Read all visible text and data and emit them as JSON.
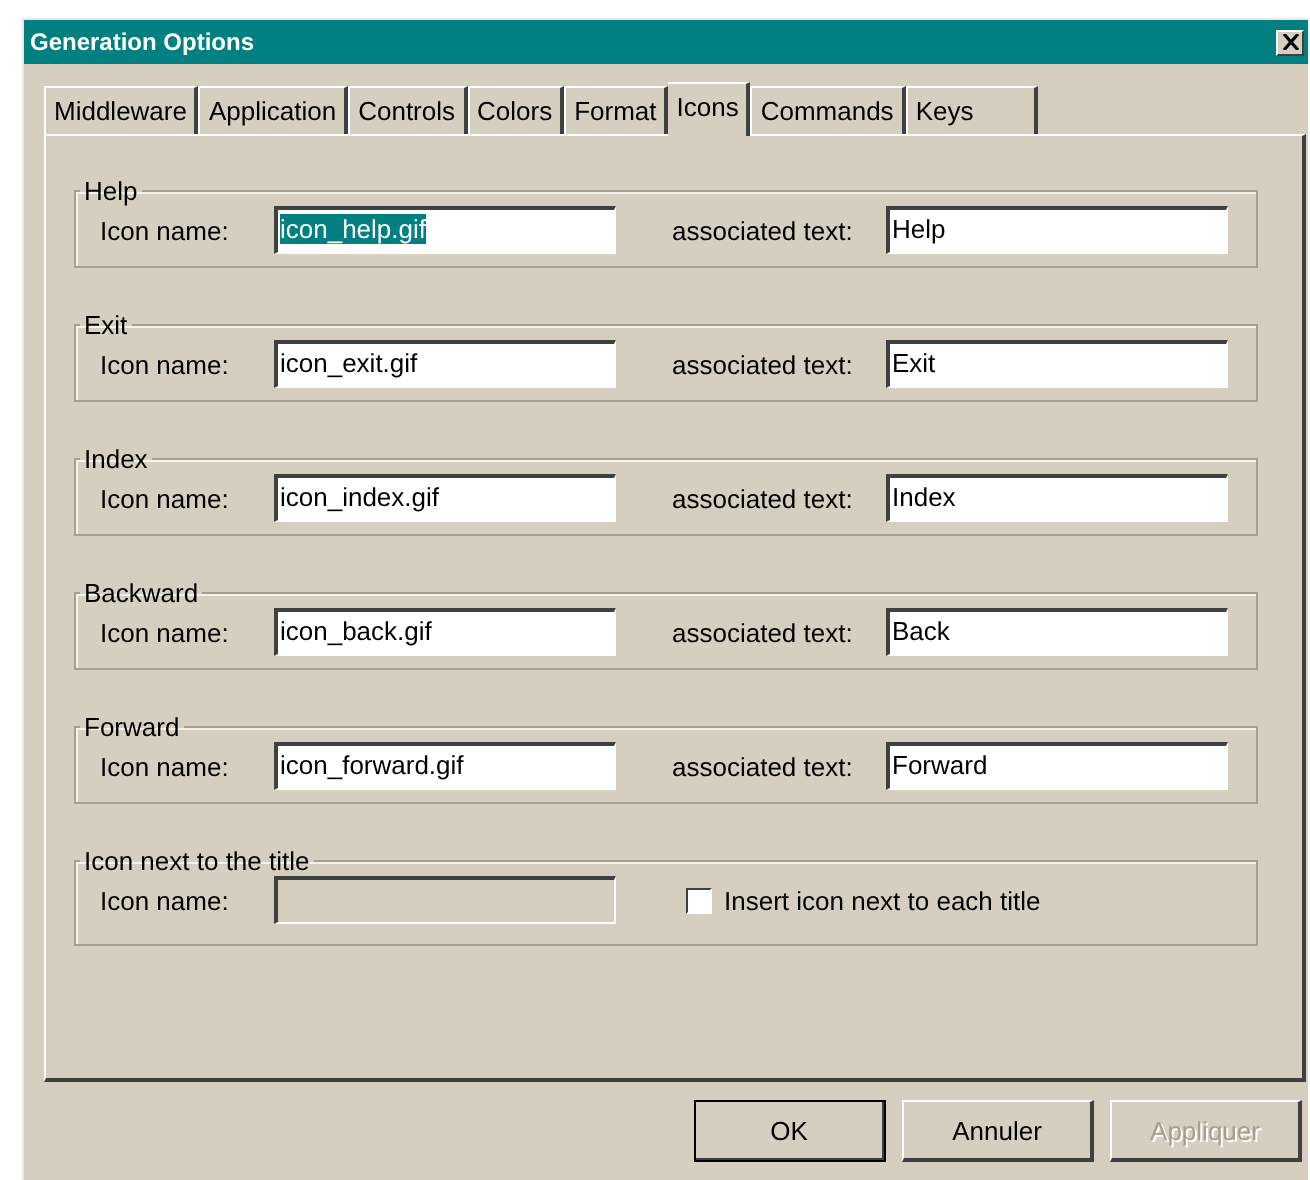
{
  "window": {
    "title": "Generation Options"
  },
  "tabs": [
    {
      "label": "Middleware",
      "selected": false
    },
    {
      "label": "Application",
      "selected": false
    },
    {
      "label": "Controls",
      "selected": false
    },
    {
      "label": "Colors",
      "selected": false
    },
    {
      "label": "Format",
      "selected": false
    },
    {
      "label": "Icons",
      "selected": true
    },
    {
      "label": "Commands",
      "selected": false
    },
    {
      "label": "Keys",
      "selected": false
    }
  ],
  "groups": [
    {
      "kind": "text",
      "title": "Help",
      "icon_label": "Icon name:",
      "icon_value": "icon_help.gif",
      "text_selected": true,
      "text_label": "associated text:",
      "text_value": "Help"
    },
    {
      "kind": "text",
      "title": "Exit",
      "icon_label": "Icon name:",
      "icon_value": "icon_exit.gif",
      "text_selected": false,
      "text_label": "associated text:",
      "text_value": "Exit"
    },
    {
      "kind": "text",
      "title": "Index",
      "icon_label": "Icon name:",
      "icon_value": "icon_index.gif",
      "text_selected": false,
      "text_label": "associated text:",
      "text_value": "Index"
    },
    {
      "kind": "text",
      "title": "Backward",
      "icon_label": "Icon name:",
      "icon_value": "icon_back.gif",
      "text_selected": false,
      "text_label": "associated text:",
      "text_value": "Back"
    },
    {
      "kind": "text",
      "title": "Forward",
      "icon_label": "Icon name:",
      "icon_value": "icon_forward.gif",
      "text_selected": false,
      "text_label": "associated text:",
      "text_value": "Forward"
    },
    {
      "kind": "checkbox",
      "title": "Icon next to the title",
      "icon_label": "Icon name:",
      "icon_disabled": true,
      "checkbox_label": "Insert icon next to each title",
      "checked": false
    }
  ],
  "buttons": [
    {
      "label": "OK",
      "default": true,
      "disabled": false
    },
    {
      "label": "Annuler",
      "default": false,
      "disabled": false
    },
    {
      "label": "Appliquer",
      "default": false,
      "disabled": true
    }
  ]
}
